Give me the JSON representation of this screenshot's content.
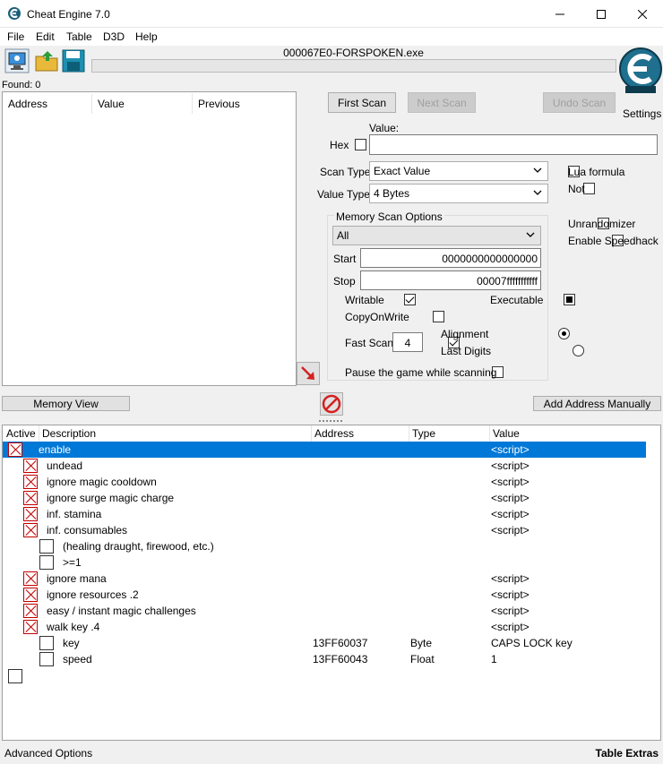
{
  "window": {
    "title": "Cheat Engine 7.0",
    "minimize_icon": "minimize-icon",
    "maximize_icon": "maximize-icon",
    "close_icon": "close-icon"
  },
  "menu": [
    "File",
    "Edit",
    "Table",
    "D3D",
    "Help"
  ],
  "toolbar": {
    "process_title": "000067E0-FORSPOKEN.exe",
    "found_label": "Found: 0",
    "settings_label": "Settings"
  },
  "results": {
    "columns": [
      "Address",
      "Value",
      "Previous"
    ]
  },
  "scan": {
    "first_scan": "First Scan",
    "next_scan": "Next Scan",
    "undo_scan": "Undo Scan",
    "value_label": "Value:",
    "hex_label": "Hex",
    "value_input": "",
    "scan_type_label": "Scan Type",
    "scan_type_value": "Exact Value",
    "value_type_label": "Value Type",
    "value_type_value": "4 Bytes",
    "lua_formula": "Lua formula",
    "not_label": "Not",
    "unrandomizer": "Unrandomizer",
    "speedhack": "Enable Speedhack"
  },
  "memory_options": {
    "title": "Memory Scan Options",
    "region_value": "All",
    "start_label": "Start",
    "start_value": "0000000000000000",
    "stop_label": "Stop",
    "stop_value": "00007fffffffffff",
    "writable": "Writable",
    "executable": "Executable",
    "copy_on_write": "CopyOnWrite",
    "fast_scan": "Fast Scan",
    "fast_scan_value": "4",
    "alignment": "Alignment",
    "last_digits": "Last Digits",
    "pause_game": "Pause the game while scanning"
  },
  "buttons": {
    "memory_view": "Memory View",
    "add_address": "Add Address Manually"
  },
  "address_table": {
    "headers": [
      "Active",
      "Description",
      "Address",
      "Type",
      "Value"
    ],
    "rows": [
      {
        "desc": "enable",
        "address": "",
        "type": "",
        "value": "<script>"
      },
      {
        "desc": "undead",
        "address": "",
        "type": "",
        "value": "<script>"
      },
      {
        "desc": "ignore magic cooldown",
        "address": "",
        "type": "",
        "value": "<script>"
      },
      {
        "desc": "ignore surge magic charge",
        "address": "",
        "type": "",
        "value": "<script>"
      },
      {
        "desc": "inf. stamina",
        "address": "",
        "type": "",
        "value": "<script>"
      },
      {
        "desc": "inf. consumables",
        "address": "",
        "type": "",
        "value": "<script>"
      },
      {
        "desc": "(healing draught, firewood, etc.)",
        "address": "",
        "type": "",
        "value": ""
      },
      {
        "desc": ">=1",
        "address": "",
        "type": "",
        "value": ""
      },
      {
        "desc": "ignore mana",
        "address": "",
        "type": "",
        "value": "<script>"
      },
      {
        "desc": "ignore resources .2",
        "address": "",
        "type": "",
        "value": "<script>"
      },
      {
        "desc": "easy / instant magic challenges",
        "address": "",
        "type": "",
        "value": "<script>"
      },
      {
        "desc": "walk key .4",
        "address": "",
        "type": "",
        "value": "<script>"
      },
      {
        "desc": "key",
        "address": "13FF60037",
        "type": "Byte",
        "value": "CAPS LOCK key"
      },
      {
        "desc": "speed",
        "address": "13FF60043",
        "type": "Float",
        "value": "1"
      }
    ]
  },
  "footer": {
    "advanced_options": "Advanced Options",
    "table_extras": "Table Extras"
  },
  "colors": {
    "selection": "#0078d7",
    "active_x": "#c00000",
    "arrow_red": "#d42020"
  }
}
